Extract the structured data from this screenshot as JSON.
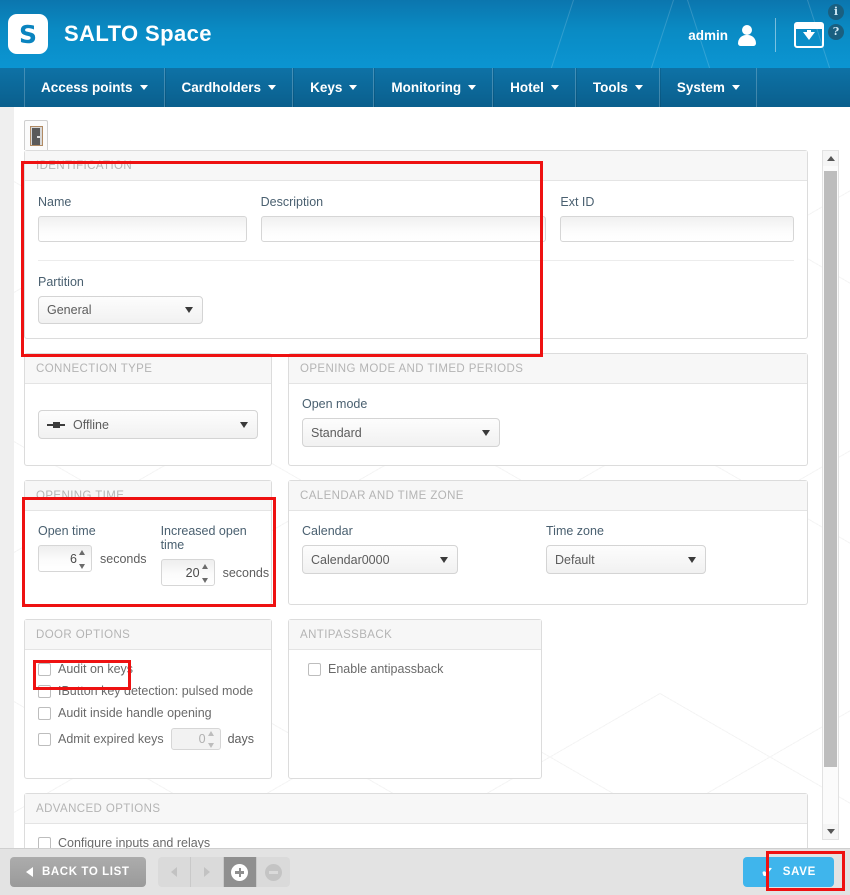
{
  "header": {
    "logo_letter": "S",
    "brand": "SALTO Space",
    "user": "admin",
    "user_icon": "user-icon",
    "download_icon": "window-download-icon",
    "info_icon": "i",
    "help_icon": "?"
  },
  "menu": [
    {
      "label": "Access points"
    },
    {
      "label": "Cardholders"
    },
    {
      "label": "Keys"
    },
    {
      "label": "Monitoring"
    },
    {
      "label": "Hotel"
    },
    {
      "label": "Tools"
    },
    {
      "label": "System"
    }
  ],
  "tab": {
    "icon": "door-icon"
  },
  "identification": {
    "title": "IDENTIFICATION",
    "name_label": "Name",
    "name_value": "",
    "description_label": "Description",
    "description_value": "",
    "ext_id_label": "Ext ID",
    "ext_id_value": "",
    "partition_label": "Partition",
    "partition_value": "General"
  },
  "connection_type": {
    "title": "CONNECTION TYPE",
    "value": "Offline",
    "icon": "plug-icon"
  },
  "opening_mode": {
    "title": "OPENING MODE AND TIMED PERIODS",
    "open_mode_label": "Open mode",
    "open_mode_value": "Standard"
  },
  "opening_time": {
    "title": "OPENING TIME",
    "open_time_label": "Open time",
    "open_time_value": "6",
    "open_time_unit": "seconds",
    "increased_label": "Increased open time",
    "increased_value": "20",
    "increased_unit": "seconds"
  },
  "calendar_tz": {
    "title": "CALENDAR AND TIME ZONE",
    "calendar_label": "Calendar",
    "calendar_value": "Calendar0000",
    "timezone_label": "Time zone",
    "timezone_value": "Default"
  },
  "door_options": {
    "title": "DOOR OPTIONS",
    "items": [
      {
        "label": "Audit on keys",
        "checked": false
      },
      {
        "label": "IButton key detection: pulsed mode",
        "checked": false
      },
      {
        "label": "Audit inside handle opening",
        "checked": false
      }
    ],
    "admit_label": "Admit expired keys",
    "admit_value": "0",
    "admit_unit": "days"
  },
  "antipassback": {
    "title": "ANTIPASSBACK",
    "item_label": "Enable antipassback"
  },
  "advanced_options": {
    "title": "ADVANCED OPTIONS",
    "item_label": "Configure inputs and relays"
  },
  "footer": {
    "back_label": "BACK TO LIST",
    "prev_icon": "chevron-left-icon",
    "next_icon": "chevron-right-icon",
    "add_icon": "plus-icon",
    "remove_icon": "minus-icon",
    "save_label": "SAVE",
    "save_check": "✔"
  },
  "colors": {
    "header_blue": "#0a8bc4",
    "menu_blue": "#0a5f8d",
    "save_blue": "#3fb5ec",
    "highlight_red": "#ee1111"
  }
}
